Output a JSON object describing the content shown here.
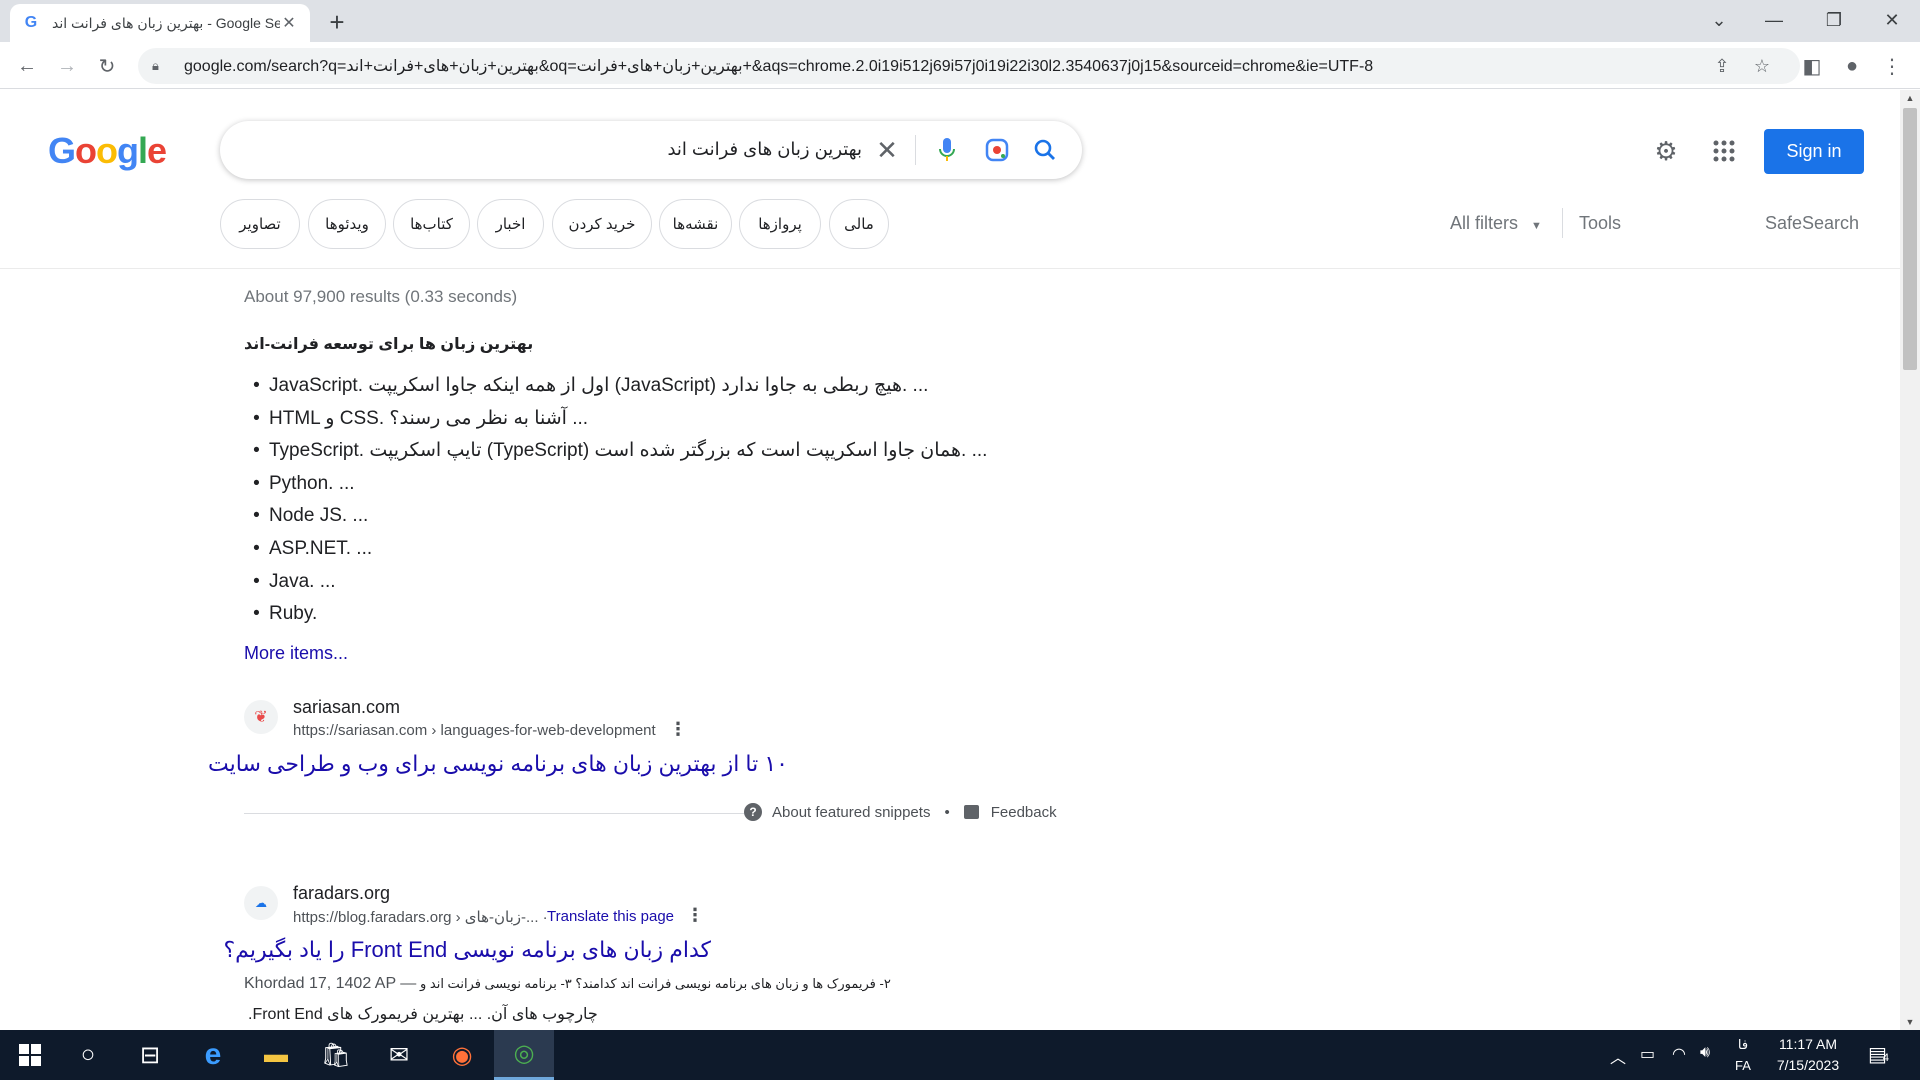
{
  "browser": {
    "tab_title": "بهترین زبان های فرانت اند - Google Search",
    "favicon": "G",
    "url": "google.com/search?q=بهترین+زبان+های+فرانت+اند&oq=بهترین+زبان+های+فرانت+&aqs=chrome.2.0i19i512j69i57j0i19i22i30l2.3540637j0j15&sourceid=chrome&ie=UTF-8"
  },
  "google": {
    "logo_letters": [
      "G",
      "o",
      "o",
      "g",
      "l",
      "e"
    ],
    "query": "بهترین زبان های فرانت اند",
    "sign_in": "Sign in",
    "chips": [
      "مالی",
      "پروازها",
      "نقشه‌ها",
      "خرید کردن",
      "اخبار",
      "کتاب‌ها",
      "ویدئوها",
      "تصاویر"
    ],
    "all_filters": "All filters",
    "tools": "Tools",
    "safesearch": "SafeSearch"
  },
  "results": {
    "stats": "About 97,900 results (0.33 seconds)",
    "featured": {
      "heading": "بهترین زبان ها برای توسعه فرانت-اند",
      "bullets": [
        "JavaScript. اول از همه اینکه جاوا اسکریپت (JavaScript) هیچ ربطی به جاوا ندارد. ...",
        "HTML و CSS. آشنا به نظر می رسند؟ ...",
        "TypeScript. تایپ اسکریپت (TypeScript) همان جاوا اسکریپت است که بزرگتر شده است. ...",
        "Python. ...",
        "Node JS. ...",
        "ASP.NET. ...",
        "Java. ...",
        "Ruby."
      ],
      "more_items": "More items...",
      "site_name": "sariasan.com",
      "site_url": "https://sariasan.com › languages-for-web-development",
      "title": "۱۰ تا از بهترین زبان های برنامه نویسی برای وب و طراحی سایت",
      "about_snippets": "About featured snippets",
      "feedback": "Feedback"
    },
    "second": {
      "site_name": "faradars.org",
      "site_url": "https://blog.faradars.org › زبان-های-... ·",
      "translate": "Translate this page",
      "title": "کدام زبان های برنامه نویسی Front End را یاد بگیریم؟",
      "date": "Khordad 17, 1402 AP —",
      "snippet_line1": "۲- فریمورک ها و زبان های برنامه نویسی فرانت اند کدامند؟ ۳- برنامه نویسی فرانت اند و",
      "snippet_line2": "چارچوب های آن. ... بهترین فریمورک های Front End."
    }
  },
  "taskbar": {
    "time": "11:17 AM",
    "date": "7/15/2023",
    "lang_top": "فا",
    "lang_bottom": "FA",
    "notif_count": "4"
  },
  "colors": {
    "link": "#1a0dab",
    "accent": "#1a73e8",
    "taskbar": "#0e1a2b"
  }
}
